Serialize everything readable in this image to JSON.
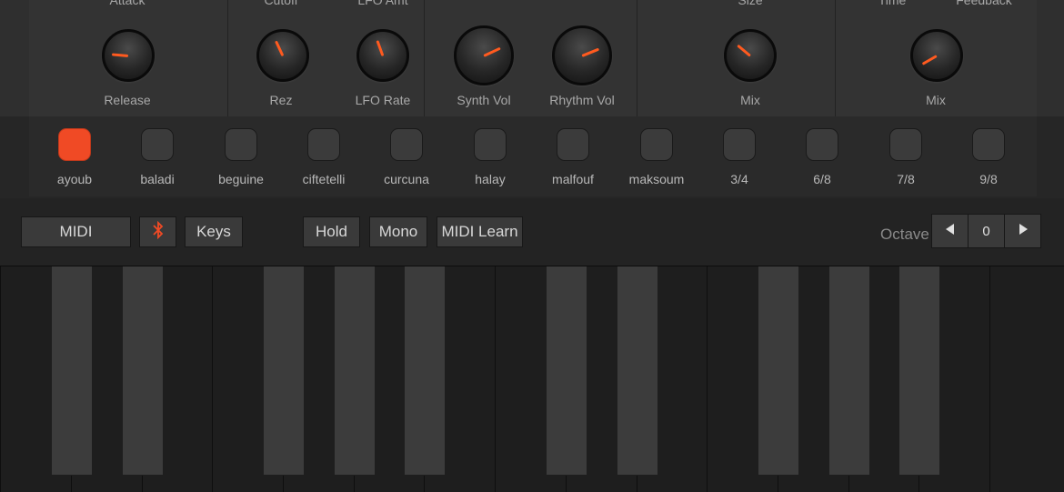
{
  "synth": {
    "sections": [
      {
        "top": "Attack",
        "bottom": "Release",
        "knob": "release-knob",
        "angle": 185
      },
      {
        "top": "Cutoff",
        "bottom": "Rez",
        "knob": "rez-knob",
        "angle": 245
      },
      {
        "top": "LFO Amt",
        "bottom": "LFO Rate",
        "knob": "lfo-rate-knob",
        "angle": 250
      },
      {
        "top": "",
        "bottom": "Synth Vol",
        "knob": "synth-vol-knob",
        "angle": 335
      },
      {
        "top": "",
        "bottom": "Rhythm Vol",
        "knob": "rhythm-vol-knob",
        "angle": 338
      },
      {
        "top": "Size",
        "bottom": "Mix",
        "knob": "reverb-mix-knob",
        "angle": 220
      },
      {
        "top": "Time",
        "bottom": "Feedback",
        "bottom2": "Mix",
        "knob": "delay-mix-knob",
        "angle": 150
      }
    ],
    "labels": {
      "attack": "Attack",
      "cutoff": "Cutoff",
      "lfo_amt": "LFO Amt",
      "size": "Size",
      "time": "Time",
      "feedback": "Feedback",
      "release": "Release",
      "rez": "Rez",
      "lfo_rate": "LFO Rate",
      "synth_vol": "Synth Vol",
      "rhythm_vol": "Rhythm Vol",
      "reverb_mix": "Mix",
      "delay_mix": "Mix"
    },
    "knob_colors": {
      "indicator": "#ff5a1f"
    }
  },
  "rhythms": {
    "active": "ayoub",
    "active_color": "#f04a25",
    "items": [
      "ayoub",
      "baladi",
      "beguine",
      "ciftetelli",
      "curcuna",
      "halay",
      "malfouf",
      "maksoum",
      "3/4",
      "6/8",
      "7/8",
      "9/8"
    ]
  },
  "controls": {
    "midi": "MIDI",
    "bluetooth_icon": "bluetooth-icon",
    "keys": "Keys",
    "hold": "Hold",
    "mono": "Mono",
    "midi_learn": "MIDI Learn",
    "octave_label": "Octave",
    "octave_value": "0",
    "octave_down_icon": "triangle-left-icon",
    "octave_up_icon": "triangle-right-icon"
  }
}
